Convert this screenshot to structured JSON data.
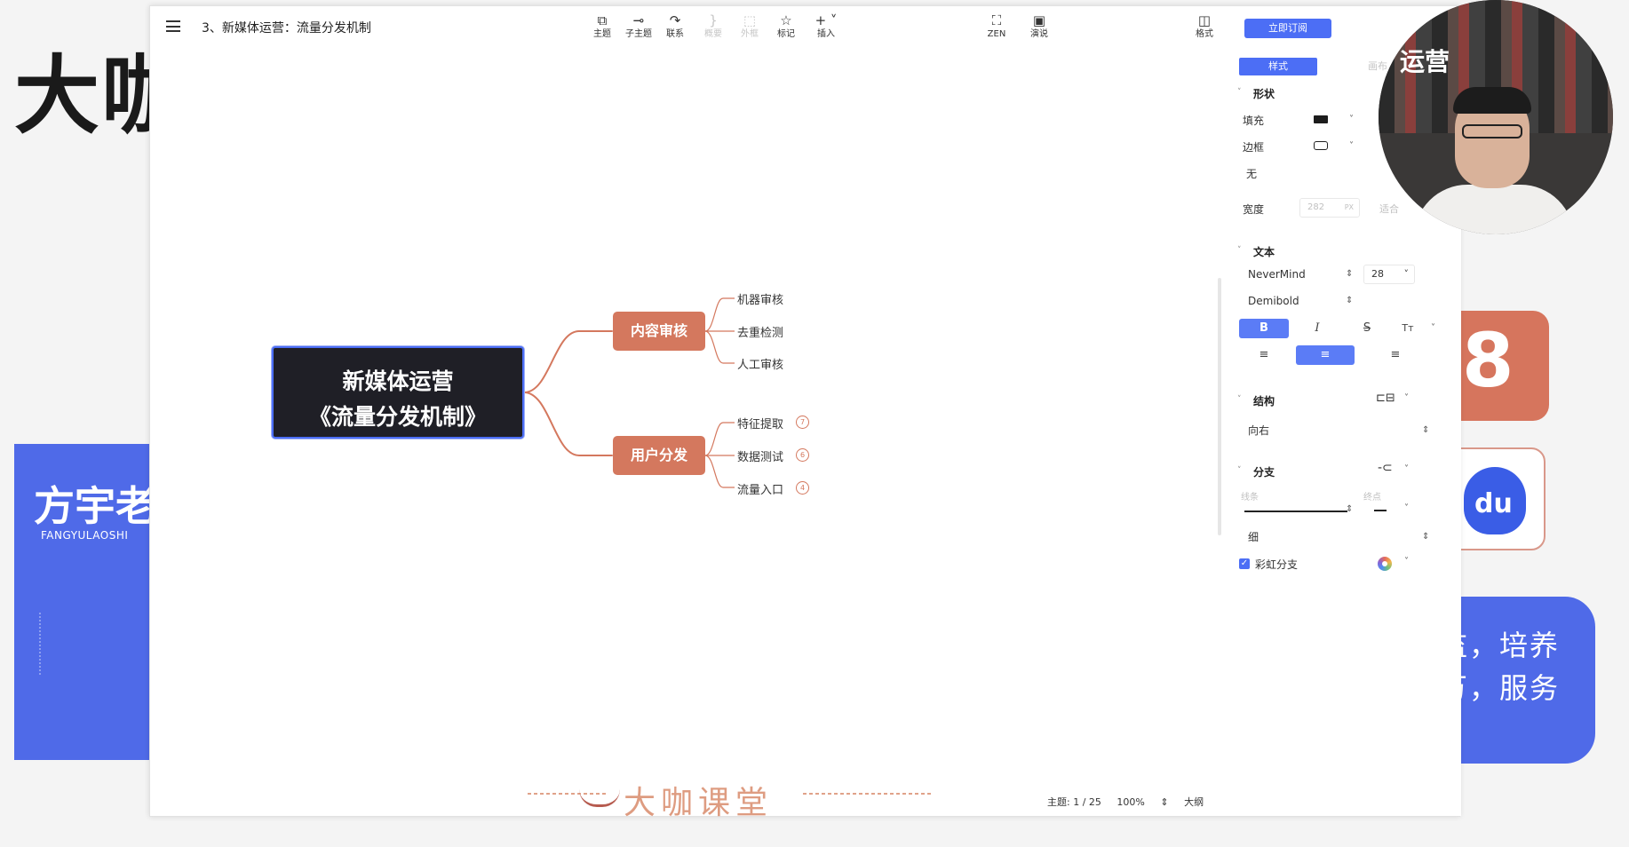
{
  "background": {
    "title": "大咖",
    "brand": "方宇老",
    "brand_sub": "FANGYULAOSHI",
    "right_text_line1": "监，培养",
    "right_text_line2": "万，服务",
    "icon1_glyph": "8",
    "icon2_text": "du",
    "webcam_banner": "运营",
    "accent_blue": "#4f6ae8",
    "accent_orange": "#d6755d"
  },
  "app": {
    "doc_title": "3、新媒体运营：流量分发机制",
    "toolbar": {
      "topic": {
        "icon": "topic-icon",
        "label": "主题"
      },
      "subtopic": {
        "icon": "subtopic-icon",
        "label": "子主题"
      },
      "relation": {
        "icon": "relationship-icon",
        "label": "联系"
      },
      "summary": {
        "icon": "summary-icon",
        "label": "概要"
      },
      "boundary": {
        "icon": "boundary-icon",
        "label": "外框"
      },
      "marker": {
        "icon": "star-icon",
        "label": "标记"
      },
      "insert": {
        "icon": "plus-icon",
        "label": "插入"
      },
      "zen": {
        "icon": "fullscreen-icon",
        "label": "ZEN"
      },
      "present": {
        "icon": "play-icon",
        "label": "演说"
      },
      "format": {
        "icon": "format-panel-icon",
        "label": "格式"
      }
    },
    "subscribe_label": "立即订阅"
  },
  "mindmap": {
    "central_line1": "新媒体运营",
    "central_line2": "《流量分发机制》",
    "branch_color": "#d4785e",
    "topics": [
      {
        "label": "内容审核",
        "children": [
          {
            "label": "机器审核"
          },
          {
            "label": "去重检测"
          },
          {
            "label": "人工审核"
          }
        ]
      },
      {
        "label": "用户分发",
        "children": [
          {
            "label": "特征提取",
            "badge": "7"
          },
          {
            "label": "数据测试",
            "badge": "6"
          },
          {
            "label": "流量入口",
            "badge": "4"
          }
        ]
      }
    ]
  },
  "watermark_text": "大咖课堂",
  "status": {
    "topic_count": "主题: 1 / 25",
    "zoom": "100%",
    "outline": "大纲"
  },
  "panel": {
    "tabs": {
      "style": "样式",
      "canvas": "画布"
    },
    "shape": {
      "title": "形状",
      "fill_label": "填充",
      "border_label": "边框",
      "none_label": "无",
      "width_label": "宽度",
      "width_value": "282",
      "width_unit": "PX",
      "fit_label": "适合"
    },
    "text": {
      "title": "文本",
      "font": "NeverMind",
      "size": "28",
      "weight": "Demibold",
      "bold": "B",
      "italic": "I",
      "strike": "S",
      "case": "Tт"
    },
    "structure": {
      "title": "结构",
      "value": "向右"
    },
    "branch": {
      "title": "分支",
      "line_label": "线条",
      "end_label": "终点",
      "thickness": "细",
      "rainbow_label": "彩虹分支",
      "rainbow_checked": true
    }
  }
}
